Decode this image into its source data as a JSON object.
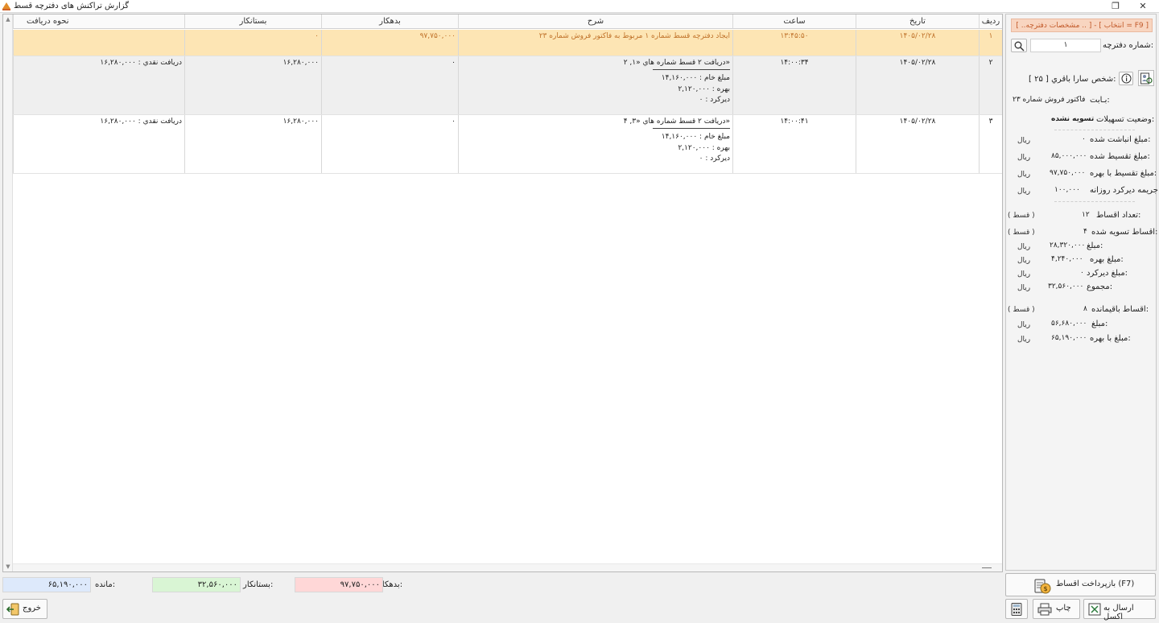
{
  "window": {
    "title": "گزارش تراكنش های دفترچه قسط",
    "close": "✕",
    "restore": "❐"
  },
  "grid": {
    "columns": [
      "رديف",
      "تاريخ",
      "ساعت",
      "شرح",
      "بدهكار",
      "بستانكار",
      "نحوه دريافت"
    ],
    "rows": [
      {
        "index": "۱",
        "date": "۱۴۰۵/۰۲/۲۸",
        "time": "۱۳:۴۵:۵۰",
        "description": "ايجاد دفترچه قسط شماره ۱ مربوط به فاكتور فروش شماره ۲۳",
        "debit": "۹۷,۷۵۰,۰۰۰",
        "credit": "۰",
        "method": ""
      },
      {
        "index": "۲",
        "date": "۱۴۰۵/۰۲/۲۸",
        "time": "۱۴:۰۰:۳۴",
        "description": "دريافت ۲ قسط شماره هاي «۱, ۲»",
        "raw": "مبلغ خام : ۱۴,۱۶۰,۰۰۰",
        "interest": "بهره : ۲,۱۲۰,۰۰۰",
        "late": "ديركرد : ۰",
        "debit": "۰",
        "credit": "۱۶,۲۸۰,۰۰۰",
        "method": "دريافت نقدي : ۱۶,۲۸۰,۰۰۰"
      },
      {
        "index": "۳",
        "date": "۱۴۰۵/۰۲/۲۸",
        "time": "۱۴:۰۰:۴۱",
        "description": "دريافت ۲ قسط شماره هاي «۳, ۴»",
        "raw": "مبلغ خام : ۱۴,۱۶۰,۰۰۰",
        "interest": "بهره : ۲,۱۲۰,۰۰۰",
        "late": "ديركرد : ۰",
        "debit": "۰",
        "credit": "۱۶,۲۸۰,۰۰۰",
        "method": "دريافت نقدي : ۱۶,۲۸۰,۰۰۰"
      }
    ]
  },
  "totals": {
    "debit_label": "بدهكار:",
    "debit_value": "۹۷,۷۵۰,۰۰۰",
    "credit_label": "بستانكار:",
    "credit_value": "۳۲,۵۶۰,۰۰۰",
    "remain_label": "مانده:",
    "remain_value": "۶۵,۱۹۰,۰۰۰",
    "debit_color": "#ffd7d7",
    "credit_color": "#d9f5d4",
    "remain_color": "#dde9fb"
  },
  "buttons": {
    "exit": "خروج",
    "excel": "ارسال به اكسل",
    "print": "چاپ",
    "repay": "بازپرداخت  اقساط (F7)"
  },
  "panel": {
    "header": "[ ..مشخصات دفترچه .. ] - [ انتخاب = F9 ]",
    "book_no_label": "شماره دفترچه:",
    "book_no_value": "۱",
    "person_label": "شخص:",
    "person_value": "سارا باقري [ ۲۵ ]",
    "for_label": "بـابت:",
    "for_value": "فاكتور فروش شماره ۲۳",
    "status_label": "وضعيت تسهيلات:",
    "status_value": "تسويه نشده",
    "accum_label": "مبلغ انباشت شده:",
    "accum_value": "۰",
    "split_label": "مبلغ تقسيط شده:",
    "split_value": "۸۵,۰۰۰,۰۰۰",
    "split_int_label": "مبلغ تقسيط با بهره:",
    "split_int_value": "۹۷,۷۵۰,۰۰۰",
    "penalty_label": "جريمه ديركرد روزانه:",
    "penalty_value": "۱۰۰,۰۰۰",
    "count_label": "تعداد اقساط:",
    "count_value": "۱۲",
    "settled_label": "اقساط تسويه شده:",
    "settled_value": "۴",
    "amount_label": "مبلغ:",
    "settled_amount": "۲۸,۳۲۰,۰۰۰",
    "interest_label": "مبلغ بهره:",
    "settled_interest": "۴,۲۴۰,۰۰۰",
    "late_label": "مبلغ ديركرد:",
    "settled_late": "۰",
    "sum_label": "مجموع:",
    "settled_sum": "۳۲,۵۶۰,۰۰۰",
    "remaining_label": "اقساط باقيمانده:",
    "remaining_value": "۸",
    "rem_amount_label": "مبلغ:",
    "rem_amount": "۵۶,۶۸۰,۰۰۰",
    "rem_int_label": "مبلغ با بهره:",
    "rem_int": "۶۵,۱۹۰,۰۰۰",
    "unit_rial": "ريال",
    "unit_qest": "( قسط )"
  }
}
